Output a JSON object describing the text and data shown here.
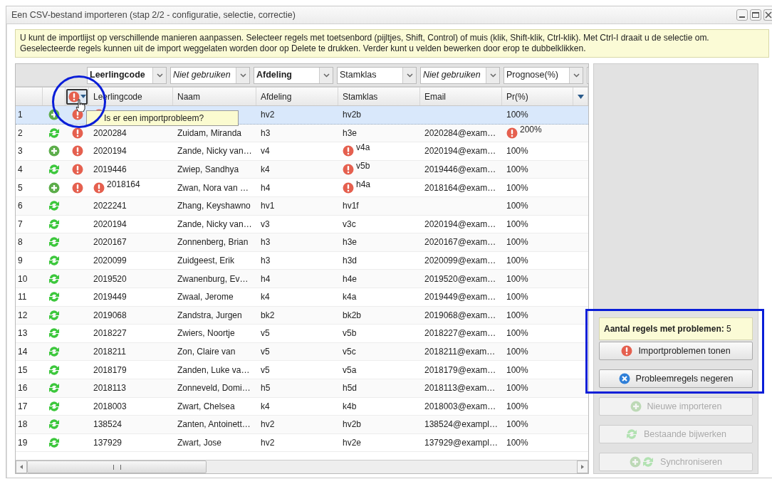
{
  "window": {
    "title": "Een CSV-bestand importeren (stap 2/2 - configuratie, selectie, correctie)"
  },
  "info": "U kunt de importlijst op verschillende manieren aanpassen. Selecteer regels met toetsenbord (pijltjes, Shift, Control) of muis (klik, Shift-klik, Ctrl-klik). Met Ctrl-I draait u de selectie om. Geselecteerde regels kunnen uit de import weggelaten worden door op Delete te drukken. Verder kunt u velden bewerken door erop te dubbelklikken.",
  "mappings": [
    {
      "label": "Leerlingcode",
      "kind": "bold"
    },
    {
      "label": "Niet gebruiken",
      "kind": "italic"
    },
    {
      "label": "Afdeling",
      "kind": "bold"
    },
    {
      "label": "Stamklas",
      "kind": "plain"
    },
    {
      "label": "Niet gebruiken",
      "kind": "italic"
    },
    {
      "label": "Prognose(%)",
      "kind": "plain"
    }
  ],
  "columns": [
    "Leerlingcode",
    "Naam",
    "Afdeling",
    "Stamklas",
    "Email",
    "Pr(%)"
  ],
  "tooltip": "Is er een importprobleem?",
  "rows": [
    {
      "num": "1",
      "new": true,
      "problem": true,
      "selected": true,
      "code_warning": true,
      "afdeling": "hv2",
      "stamklas": "hv2b",
      "stamklas_warning": false,
      "pr": "100%",
      "pr_warning": false
    },
    {
      "num": "2",
      "new": false,
      "problem": true,
      "selected": false,
      "code": "2020284",
      "code_warning": false,
      "name": "Zuidam, Miranda",
      "afdeling": "h3",
      "stamklas": "h3e",
      "stamklas_warning": false,
      "email": "2020284@exam…",
      "pr": "200%",
      "pr_warning": true
    },
    {
      "num": "3",
      "new": true,
      "problem": true,
      "selected": false,
      "code": "2020194",
      "code_warning": false,
      "name": "Zande, Nicky van…",
      "afdeling": "v4",
      "stamklas": "v4a",
      "stamklas_warning": true,
      "email": "2020194@exam…",
      "pr": "100%",
      "pr_warning": false
    },
    {
      "num": "4",
      "new": false,
      "problem": true,
      "selected": false,
      "code": "2019446",
      "code_warning": false,
      "name": "Zwiep, Sandhya",
      "afdeling": "k4",
      "stamklas": "v5b",
      "stamklas_warning": true,
      "email": "2019446@exam…",
      "pr": "100%",
      "pr_warning": false
    },
    {
      "num": "5",
      "new": true,
      "problem": true,
      "selected": false,
      "code": "2018164",
      "code_warning": true,
      "name": "Zwan, Nora van …",
      "afdeling": "h4",
      "stamklas": "h4a",
      "stamklas_warning": true,
      "email": "2018164@exam…",
      "pr": "100%",
      "pr_warning": false
    },
    {
      "num": "6",
      "new": false,
      "problem": false,
      "selected": false,
      "code": "2022241",
      "code_warning": false,
      "name": "Zhang, Keyshawno",
      "afdeling": "hv1",
      "stamklas": "hv1f",
      "stamklas_warning": false,
      "pr": "100%",
      "pr_warning": false
    },
    {
      "num": "7",
      "new": false,
      "problem": false,
      "selected": false,
      "code": "2020194",
      "code_warning": false,
      "name": "Zande, Nicky van…",
      "afdeling": "v3",
      "stamklas": "v3c",
      "stamklas_warning": false,
      "email": "2020194@exam…",
      "pr": "100%",
      "pr_warning": false
    },
    {
      "num": "8",
      "new": false,
      "problem": false,
      "selected": false,
      "code": "2020167",
      "code_warning": false,
      "name": "Zonnenberg, Brian",
      "afdeling": "h3",
      "stamklas": "h3e",
      "stamklas_warning": false,
      "email": "2020167@exam…",
      "pr": "100%",
      "pr_warning": false
    },
    {
      "num": "9",
      "new": false,
      "problem": false,
      "selected": false,
      "code": "2020099",
      "code_warning": false,
      "name": "Zuidgeest, Erik",
      "afdeling": "h3",
      "stamklas": "h3d",
      "stamklas_warning": false,
      "email": "2020099@exam…",
      "pr": "100%",
      "pr_warning": false
    },
    {
      "num": "10",
      "new": false,
      "problem": false,
      "selected": false,
      "code": "2019520",
      "code_warning": false,
      "name": "Zwanenburg, Ev…",
      "afdeling": "h4",
      "stamklas": "h4e",
      "stamklas_warning": false,
      "email": "2019520@exam…",
      "pr": "100%",
      "pr_warning": false
    },
    {
      "num": "11",
      "new": false,
      "problem": false,
      "selected": false,
      "code": "2019449",
      "code_warning": false,
      "name": "Zwaal, Jerome",
      "afdeling": "k4",
      "stamklas": "k4a",
      "stamklas_warning": false,
      "email": "2019449@exam…",
      "pr": "100%",
      "pr_warning": false
    },
    {
      "num": "12",
      "new": false,
      "problem": false,
      "selected": false,
      "code": "2019068",
      "code_warning": false,
      "name": "Zandstra, Jurgen",
      "afdeling": "bk2",
      "stamklas": "bk2b",
      "stamklas_warning": false,
      "email": "2019068@exam…",
      "pr": "100%",
      "pr_warning": false
    },
    {
      "num": "13",
      "new": false,
      "problem": false,
      "selected": false,
      "code": "2018227",
      "code_warning": false,
      "name": "Zwiers, Noortje",
      "afdeling": "v5",
      "stamklas": "v5b",
      "stamklas_warning": false,
      "email": "2018227@exam…",
      "pr": "100%",
      "pr_warning": false
    },
    {
      "num": "14",
      "new": false,
      "problem": false,
      "selected": false,
      "code": "2018211",
      "code_warning": false,
      "name": "Zon, Claire van",
      "afdeling": "v5",
      "stamklas": "v5c",
      "stamklas_warning": false,
      "email": "2018211@exam…",
      "pr": "100%",
      "pr_warning": false
    },
    {
      "num": "15",
      "new": false,
      "problem": false,
      "selected": false,
      "code": "2018179",
      "code_warning": false,
      "name": "Zanden, Luke va…",
      "afdeling": "v5",
      "stamklas": "v5a",
      "stamklas_warning": false,
      "email": "2018179@exam…",
      "pr": "100%",
      "pr_warning": false
    },
    {
      "num": "16",
      "new": false,
      "problem": false,
      "selected": false,
      "code": "2018113",
      "code_warning": false,
      "name": "Zonneveld, Domi…",
      "afdeling": "h5",
      "stamklas": "h5d",
      "stamklas_warning": false,
      "email": "2018113@exam…",
      "pr": "100%",
      "pr_warning": false
    },
    {
      "num": "17",
      "new": false,
      "problem": false,
      "selected": false,
      "code": "2018003",
      "code_warning": false,
      "name": "Zwart, Chelsea",
      "afdeling": "k4",
      "stamklas": "k4b",
      "stamklas_warning": false,
      "email": "2018003@exam…",
      "pr": "100%",
      "pr_warning": false
    },
    {
      "num": "18",
      "new": false,
      "problem": false,
      "selected": false,
      "code": "138524",
      "code_warning": false,
      "name": "Zanten, Antoinett…",
      "afdeling": "hv2",
      "stamklas": "hv2b",
      "stamklas_warning": false,
      "email": "138524@exampl…",
      "pr": "100%",
      "pr_warning": false
    },
    {
      "num": "19",
      "new": false,
      "problem": false,
      "selected": false,
      "code": "137929",
      "code_warning": false,
      "name": "Zwart, Jose",
      "afdeling": "hv2",
      "stamklas": "hv2e",
      "stamklas_warning": false,
      "email": "137929@exampl…",
      "pr": "100%",
      "pr_warning": false
    }
  ],
  "problem_count": {
    "label": "Aantal regels met problemen:",
    "value": "5"
  },
  "actions": [
    {
      "label": "Importproblemen tonen",
      "kind": "warning",
      "disabled": false
    },
    {
      "label": "Probleemregels negeren",
      "kind": "ignore",
      "disabled": false
    },
    {
      "label": "Nieuwe importeren",
      "kind": "new",
      "disabled": true
    },
    {
      "label": "Bestaande bijwerken",
      "kind": "update",
      "disabled": true
    },
    {
      "label": "Synchroniseren",
      "kind": "sync",
      "disabled": true
    }
  ]
}
